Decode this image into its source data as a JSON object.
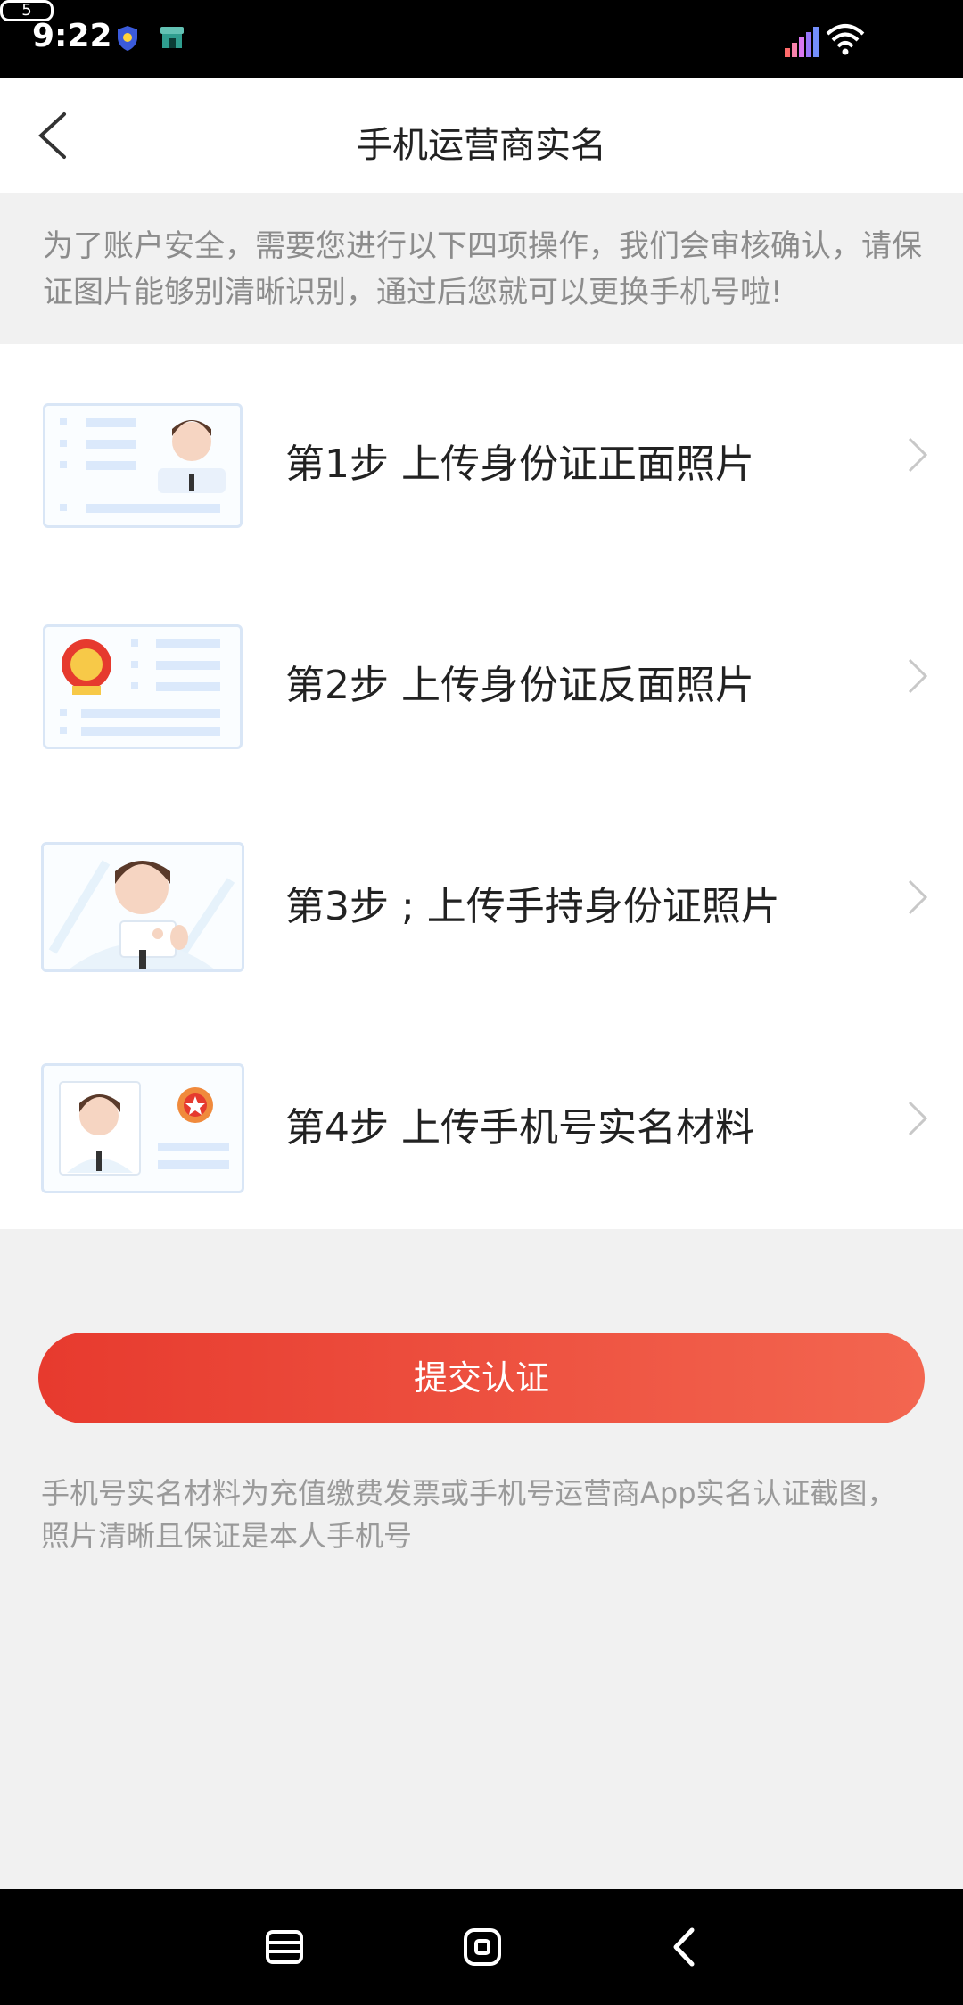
{
  "status_bar": {
    "time": "9:22",
    "battery": "5"
  },
  "header": {
    "title": "手机运营商实名",
    "back_label": "<"
  },
  "notice": "为了账户安全，需要您进行以下四项操作，我们会审核确认，请保证图片能够别清晰识别，通过后您就可以更换手机号啦!",
  "steps": [
    {
      "label": "第1步  上传身份证正面照片",
      "icon": "id-card-front-icon"
    },
    {
      "label": "第2步  上传身份证反面照片",
      "icon": "id-card-back-icon"
    },
    {
      "label": "第3步 ; 上传手持身份证照片",
      "icon": "hand-held-id-icon"
    },
    {
      "label": "第4步  上传手机号实名材料",
      "icon": "phone-realname-material-icon"
    }
  ],
  "submit_label": "提交认证",
  "footnote": "手机号实名材料为充值缴费发票或手机号运营商App实名认证截图，照片清晰且保证是本人手机号",
  "colors": {
    "accent_start": "#e73a2e",
    "accent_end": "#f36650",
    "muted_text": "#8c8c8c",
    "background": "#f1f1f1"
  }
}
